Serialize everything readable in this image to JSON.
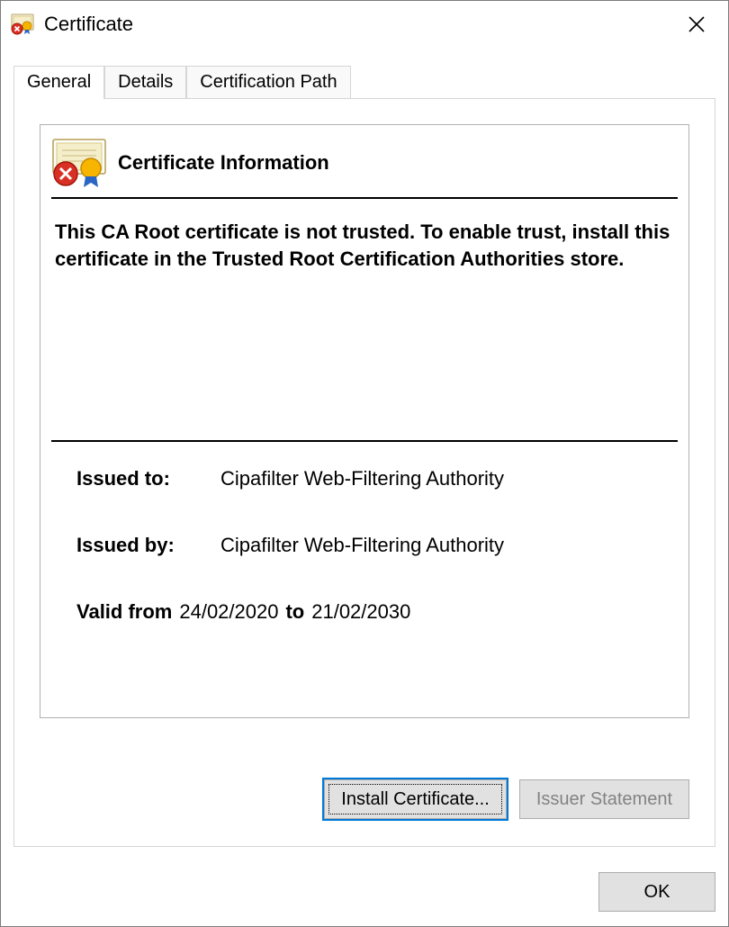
{
  "window": {
    "title": "Certificate",
    "close_label": "Close"
  },
  "tabs": {
    "general": "General",
    "details": "Details",
    "cert_path": "Certification Path",
    "active": "general"
  },
  "info": {
    "heading": "Certificate Information",
    "warning": "This CA Root certificate is not trusted. To enable trust, install this certificate in the Trusted Root Certification Authorities store."
  },
  "fields": {
    "issued_to_label": "Issued to:",
    "issued_to_value": "Cipafilter Web-Filtering Authority",
    "issued_by_label": "Issued by:",
    "issued_by_value": "Cipafilter Web-Filtering Authority",
    "valid_from_label": "Valid from",
    "valid_from_value": "24/02/2020",
    "valid_to_label": "to",
    "valid_to_value": "21/02/2030"
  },
  "buttons": {
    "install": "Install Certificate...",
    "issuer_statement": "Issuer Statement",
    "ok": "OK"
  }
}
